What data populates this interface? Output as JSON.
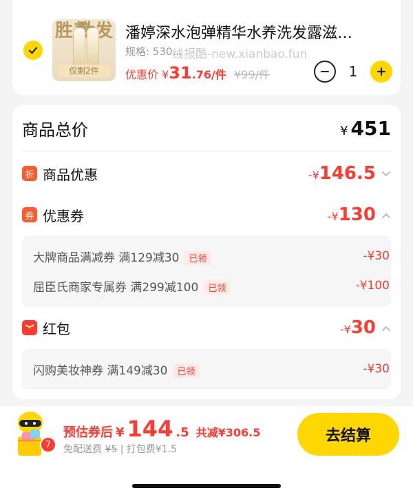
{
  "product": {
    "title": "潘婷深水泡弹精华水养洗发露滋…",
    "spec": "规格: 530...",
    "watermark": "线报酷-new.xianbao.fun",
    "thumb_text_left": "胜养",
    "thumb_text_right": "肽发",
    "stock_label": "仅剩2件",
    "price_label": "优惠价",
    "price_yen": "¥",
    "price_int": "31",
    "price_frac": ".76/件",
    "old_price": "¥99/件",
    "qty": "1"
  },
  "summary": {
    "total_label": "商品总价",
    "total_yen": "¥",
    "total_value": "451",
    "discount_tag": "折",
    "discount_label": "商品优惠",
    "discount_pre": "-¥",
    "discount_value": "146.5",
    "coupon_tag": "券",
    "coupon_label": "优惠券",
    "coupon_pre": "-¥",
    "coupon_value": "130",
    "coupons": [
      {
        "name": "大牌商品满减券  满129减30",
        "badge": "已领",
        "amount": "-¥30"
      },
      {
        "name": "屈臣氏商家专属券  满299减100",
        "badge": "已领",
        "amount": "-¥100"
      }
    ],
    "redpacket_label": "红包",
    "redpacket_pre": "-¥",
    "redpacket_value": "30",
    "redpackets": [
      {
        "name": "闪购美妆神券  满149减30",
        "badge": "已领",
        "amount": "-¥30"
      }
    ]
  },
  "footer": {
    "cart_count": "7",
    "est_label": "预估券后",
    "est_yen": "¥",
    "est_int": "144",
    "est_frac": ".5",
    "save_text": "共减¥306.5",
    "ship_free": "免配送费",
    "ship_old": "¥5",
    "ship_pack": "| 打包费¥1.5",
    "checkout_label": "去结算"
  },
  "colors": {
    "accent_yellow": "#ffd700",
    "price_red": "#ff3b30"
  }
}
